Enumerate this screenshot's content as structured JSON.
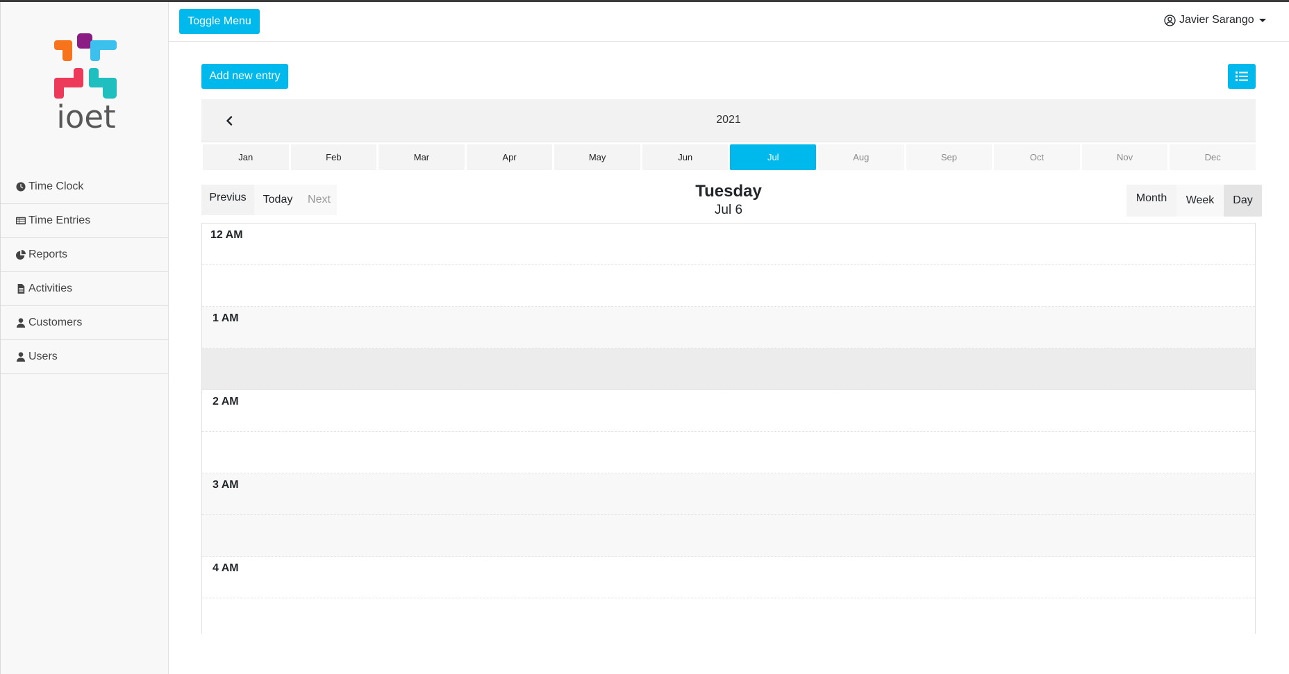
{
  "app": {
    "brand": "ioet"
  },
  "header": {
    "toggle_label": "Toggle Menu",
    "user_name": "Javier Sarango"
  },
  "sidebar": {
    "items": [
      {
        "label": "Time Clock",
        "icon": "clock-icon"
      },
      {
        "label": "Time Entries",
        "icon": "list-icon"
      },
      {
        "label": "Reports",
        "icon": "pie-chart-icon"
      },
      {
        "label": "Activities",
        "icon": "file-icon"
      },
      {
        "label": "Customers",
        "icon": "user-icon"
      },
      {
        "label": "Users",
        "icon": "user-icon"
      }
    ]
  },
  "toolbar": {
    "add_label": "Add new entry",
    "list_view_icon": "list-icon"
  },
  "calendar": {
    "year": "2021",
    "months": [
      "Jan",
      "Feb",
      "Mar",
      "Apr",
      "May",
      "Jun",
      "Jul",
      "Aug",
      "Sep",
      "Oct",
      "Nov",
      "Dec"
    ],
    "selected_month": "Jul",
    "nav": {
      "previous": "Previus",
      "today": "Today",
      "next": "Next"
    },
    "day_name": "Tuesday",
    "day_date": "Jul 6",
    "views": {
      "month": "Month",
      "week": "Week",
      "day": "Day"
    },
    "active_view": "Day",
    "hours": [
      "12 AM",
      "1 AM",
      "2 AM",
      "3 AM",
      "4 AM"
    ]
  },
  "colors": {
    "accent": "#00b9ec",
    "logo_orange": "#f7731c",
    "logo_purple": "#8a1c84",
    "logo_blue": "#3cc0ee",
    "logo_red": "#ee3a5a",
    "logo_teal": "#1fbfbf",
    "logo_text": "#585858"
  }
}
